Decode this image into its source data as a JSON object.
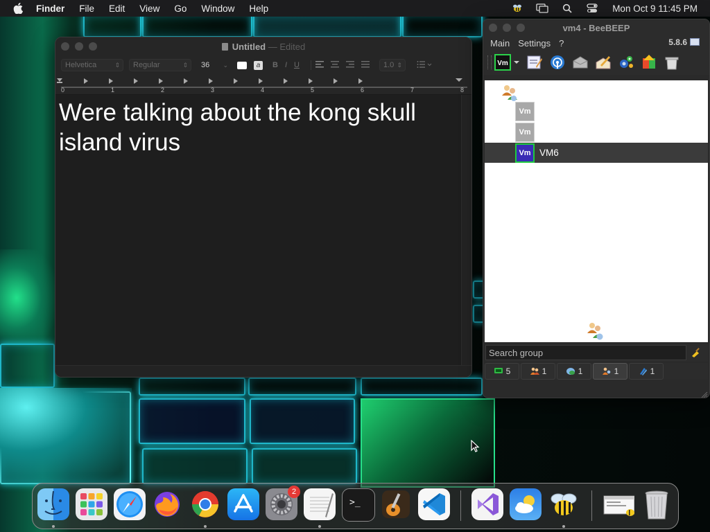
{
  "menubar": {
    "app_name": "Finder",
    "items": [
      "File",
      "Edit",
      "View",
      "Go",
      "Window",
      "Help"
    ],
    "clock": "Mon Oct 9  11:45 PM",
    "status_icons": [
      "beebeep-status-icon",
      "screen-mirroring-icon",
      "spotlight-search-icon",
      "control-center-icon"
    ]
  },
  "textedit": {
    "title": "Untitled",
    "title_separator": "—",
    "title_status": "Edited",
    "toolbar": {
      "font_family": "Helvetica",
      "font_style": "Regular",
      "font_size": "36",
      "line_spacing": "1.0",
      "bold": "B",
      "italic": "I",
      "underline": "U"
    },
    "ruler_labels": [
      "0",
      "1",
      "2",
      "3",
      "4",
      "5",
      "6",
      "7",
      "8"
    ],
    "document_text": "Were talking about the kong skull island virus"
  },
  "beebeep": {
    "title": "vm4 - BeeBEEP",
    "menu": [
      "Main",
      "Settings",
      "?"
    ],
    "version": "5.8.6",
    "users": [
      {
        "icon": "Vm",
        "name": "",
        "selected": false
      },
      {
        "icon": "Vm",
        "name": "",
        "selected": false
      },
      {
        "icon": "Vm",
        "name": "VM6",
        "selected": true
      }
    ],
    "search_placeholder": "Search group",
    "tabs": [
      {
        "icon": "chat-icon",
        "count": "5"
      },
      {
        "icon": "users-icon",
        "count": "1"
      },
      {
        "icon": "network-icon",
        "count": "1"
      },
      {
        "icon": "group-icon",
        "count": "1",
        "active": true
      },
      {
        "icon": "files-icon",
        "count": "1"
      }
    ]
  },
  "dock": {
    "items": [
      "Finder",
      "Launchpad",
      "Safari",
      "Firefox",
      "Google Chrome",
      "App Store",
      "System Settings",
      "TextEdit",
      "Terminal",
      "GarageBand",
      "Visual Studio Code",
      "Visual Studio",
      "Weather",
      "BeeBEEP",
      "Screenshot",
      "Trash"
    ],
    "system_settings_badge": "2"
  },
  "colors": {
    "selection_bg": "#3b3b3b",
    "vm_selected_bg": "#3a2bb5",
    "vm_selected_border": "#1ecb3e",
    "badge_red": "#e53935"
  }
}
